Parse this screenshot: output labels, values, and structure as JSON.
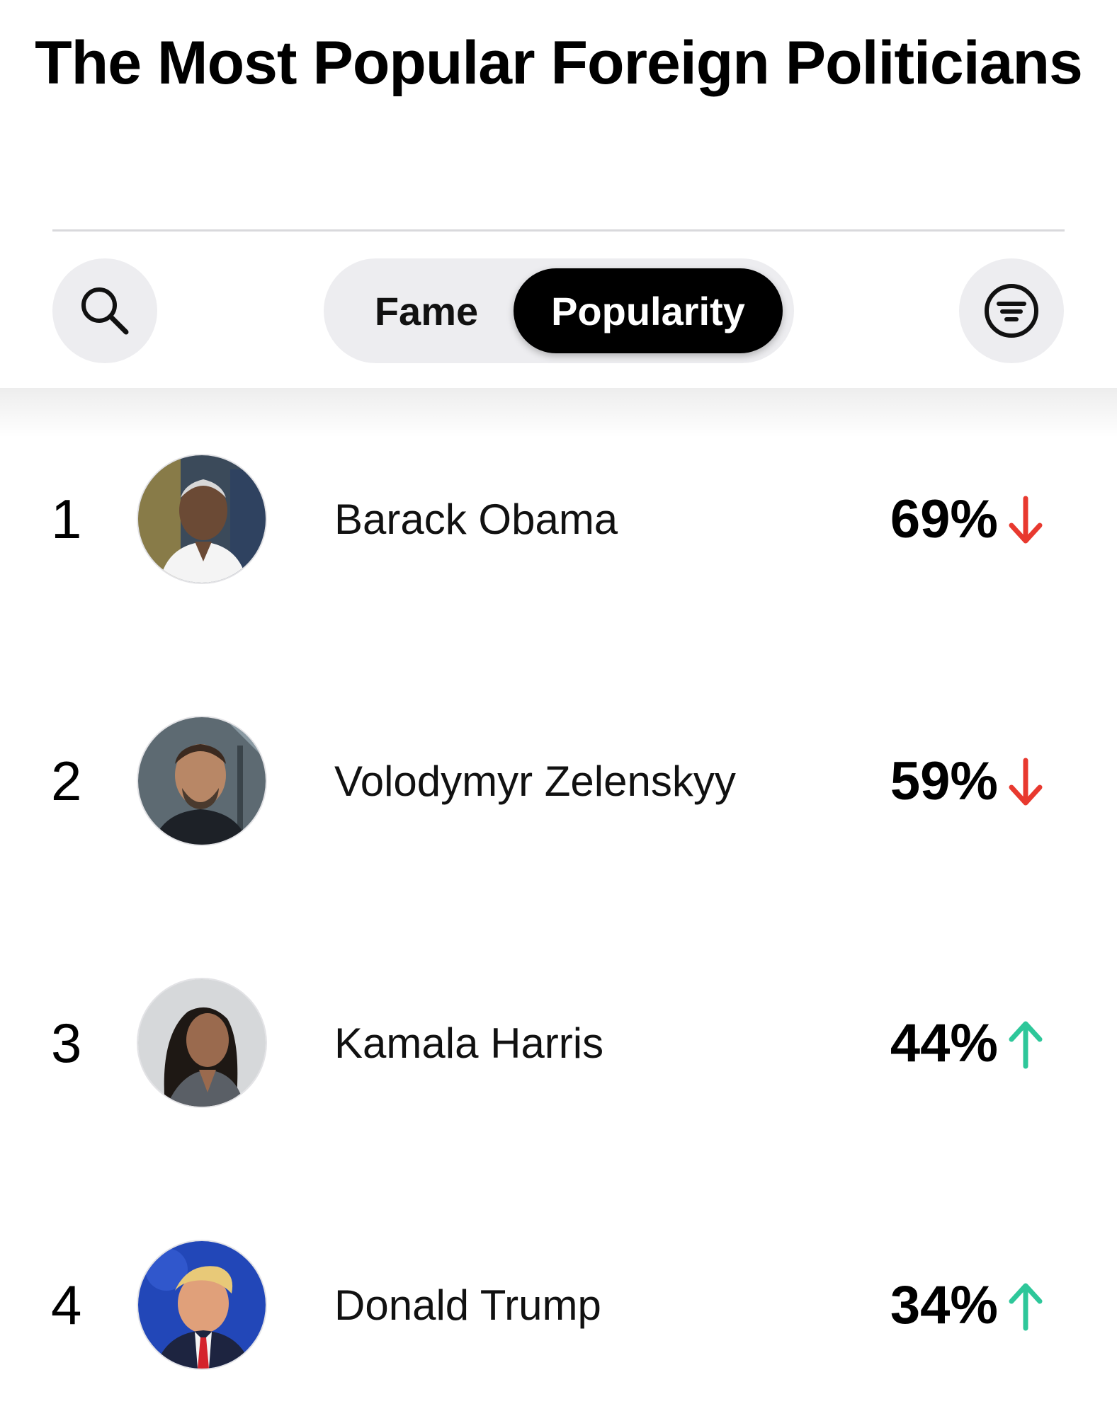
{
  "title": "The Most Popular Foreign Politicians",
  "toolbar": {
    "search_icon": "search-icon",
    "filter_icon": "filter-lines-icon",
    "tabs": [
      {
        "label": "Fame",
        "selected": false
      },
      {
        "label": "Popularity",
        "selected": true
      }
    ]
  },
  "colors": {
    "down": "#e8392f",
    "up": "#2ec79a",
    "pill_background": "#ededf0",
    "selected_pill": "#000000"
  },
  "rankings": [
    {
      "rank": "1",
      "name": "Barack Obama",
      "percent": "69%",
      "trend": "down",
      "trend_icon": "arrow-down-icon"
    },
    {
      "rank": "2",
      "name": "Volodymyr Zelenskyy",
      "percent": "59%",
      "trend": "down",
      "trend_icon": "arrow-down-icon"
    },
    {
      "rank": "3",
      "name": "Kamala Harris",
      "percent": "44%",
      "trend": "up",
      "trend_icon": "arrow-up-icon"
    },
    {
      "rank": "4",
      "name": "Donald Trump",
      "percent": "34%",
      "trend": "up",
      "trend_icon": "arrow-up-icon"
    }
  ]
}
